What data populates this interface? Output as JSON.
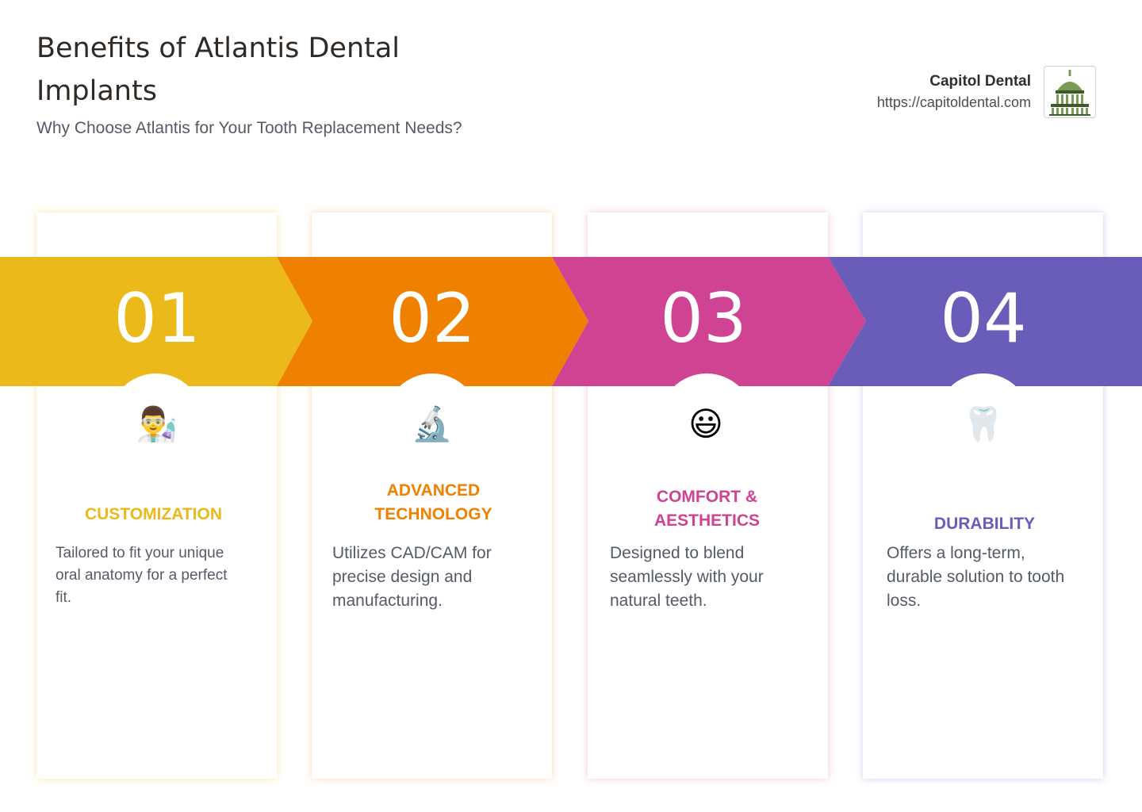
{
  "header": {
    "title": "Benefits of Atlantis Dental Implants",
    "subtitle": "Why Choose Atlantis for Your Tooth Replacement Needs?"
  },
  "brand": {
    "name": "Capitol Dental",
    "url": "https://capitoldental.com",
    "logo_icon": "capitol-dome-icon"
  },
  "steps": [
    {
      "number": "01",
      "icon": "scientist-icon",
      "emoji": "👨‍🔬",
      "title": "CUSTOMIZATION",
      "description": "Tailored to fit your unique oral anatomy for a perfect fit.",
      "color": "#ebb91a"
    },
    {
      "number": "02",
      "icon": "microscope-icon",
      "emoji": "🔬",
      "title": "ADVANCED TECHNOLOGY",
      "description": "Utilizes CAD/CAM for precise design and manufacturing.",
      "color": "#f08000"
    },
    {
      "number": "03",
      "icon": "smiling-face-icon",
      "emoji": "😃",
      "title": "COMFORT & AESTHETICS",
      "description": "Designed to blend seamlessly with your natural teeth.",
      "color": "#d04292"
    },
    {
      "number": "04",
      "icon": "tooth-icon",
      "emoji": "🦷",
      "title": "DURABILITY",
      "description": "Offers a long-term, durable solution to tooth loss.",
      "color": "#6a5cb9"
    }
  ]
}
